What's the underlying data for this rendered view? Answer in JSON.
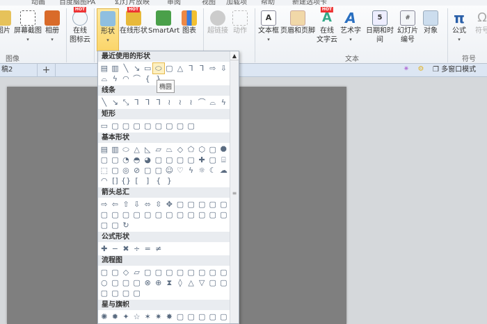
{
  "menu_tabs": [
    "动画",
    "百度脑图PA",
    "幻灯片放映",
    "审阅",
    "视图",
    "加载项",
    "帮助",
    "新建选项卡"
  ],
  "ribbon": {
    "picture": "图片",
    "screenshot": "屏幕截图",
    "album": "相册",
    "icon_cloud": [
      "在线",
      "图标云"
    ],
    "shapes": "形状",
    "online_shapes": "在线形状",
    "smartart": "SmartArt",
    "chart": "图表",
    "hyperlink": "超链接",
    "action": "动作",
    "textbox": "文本框",
    "header_footer": "页眉和页脚",
    "word_cloud": [
      "在线",
      "文字云"
    ],
    "wordart": "艺术字",
    "datetime": "日期和时间",
    "slide_number": [
      "幻灯片",
      "编号"
    ],
    "object": "对象",
    "equation": "公式",
    "symbol": "符号",
    "hot": "HOT",
    "groups": {
      "image": "图像",
      "text": "文本",
      "symbols": "符号"
    }
  },
  "docbar": {
    "tab": "稿2",
    "new_tab": "+",
    "multiwindow": "多窗口模式"
  },
  "tooltip": "椭圆",
  "shapes_gallery": [
    {
      "title": "最近使用的形状",
      "icons": [
        "textbox",
        "vertical-textbox",
        "line",
        "arrow-line",
        "rectangle",
        "oval",
        "rounded-rectangle",
        "triangle",
        "elbow-connector",
        "elbow-arrow-connector",
        "right-arrow",
        "down-arrow",
        "freeform",
        "lightning",
        "arc",
        "curve",
        "left-brace",
        "right-brace"
      ]
    },
    {
      "title": "线条",
      "icons": [
        "line",
        "arrow",
        "double-arrow",
        "elbow",
        "elbow-arrow",
        "elbow-double-arrow",
        "curved",
        "curved-arrow",
        "curved-double-arrow",
        "curve",
        "freeform",
        "scribble"
      ]
    },
    {
      "title": "矩形",
      "icons": [
        "rectangle",
        "rounded-rectangle",
        "snip-corner",
        "snip-same-side",
        "snip-diagonal",
        "snip-round",
        "round-single",
        "round-same-side",
        "round-diagonal"
      ]
    },
    {
      "title": "基本形状",
      "icons": [
        "textbox",
        "vertical-textbox",
        "oval",
        "triangle",
        "right-triangle",
        "parallelogram",
        "trapezoid",
        "diamond",
        "pentagon",
        "hexagon",
        "heptagon",
        "octagon",
        "decagon",
        "dodecagon",
        "pie",
        "chord",
        "teardrop",
        "frame",
        "half-frame",
        "l-shape",
        "diagonal-stripe",
        "cross",
        "plaque",
        "can",
        "cube",
        "bevel",
        "donut",
        "no-symbol",
        "block-arc",
        "folded-corner",
        "smiley",
        "heart",
        "lightning",
        "sun",
        "moon",
        "cloud",
        "arc",
        "double-bracket",
        "double-brace",
        "left-bracket",
        "right-bracket",
        "left-brace",
        "right-brace"
      ]
    },
    {
      "title": "箭头总汇",
      "icons": [
        "right-arrow",
        "left-arrow",
        "up-arrow",
        "down-arrow",
        "left-right-arrow",
        "up-down-arrow",
        "quad-arrow",
        "left-right-up-arrow",
        "bent-arrow",
        "u-turn-arrow",
        "left-up-arrow",
        "bent-up-arrow",
        "curved-right-arrow",
        "curved-left-arrow",
        "curved-up-arrow",
        "curved-down-arrow",
        "striped-right-arrow",
        "notched-right-arrow",
        "pentagon-arrow",
        "chevron",
        "right-callout",
        "down-callout",
        "left-callout",
        "up-callout",
        "left-right-callout",
        "quad-callout",
        "circular-arrow"
      ]
    },
    {
      "title": "公式形状",
      "icons": [
        "plus",
        "minus",
        "multiply",
        "divide",
        "equal",
        "not-equal"
      ]
    },
    {
      "title": "流程图",
      "icons": [
        "process",
        "alternate-process",
        "decision",
        "data",
        "predefined-process",
        "internal-storage",
        "document",
        "multidocument",
        "terminator",
        "preparation",
        "manual-input",
        "manual-operation",
        "connector",
        "off-page-connector",
        "card",
        "punched-tape",
        "summing-junction",
        "or",
        "collate",
        "sort",
        "extract",
        "merge",
        "stored-data",
        "delay",
        "sequential-access",
        "magnetic-disk",
        "direct-access",
        "display"
      ]
    },
    {
      "title": "星与旗帜",
      "icons": [
        "explosion1",
        "explosion2",
        "star4",
        "star5",
        "star6",
        "star7",
        "star8",
        "star10",
        "star12",
        "star16",
        "star24",
        "star32"
      ]
    }
  ],
  "colors": {
    "ribbon_bg": "#eef1f5",
    "selected": "#fbd56a",
    "slide": "#7f7f7f",
    "docbar": "#dce6f3"
  }
}
